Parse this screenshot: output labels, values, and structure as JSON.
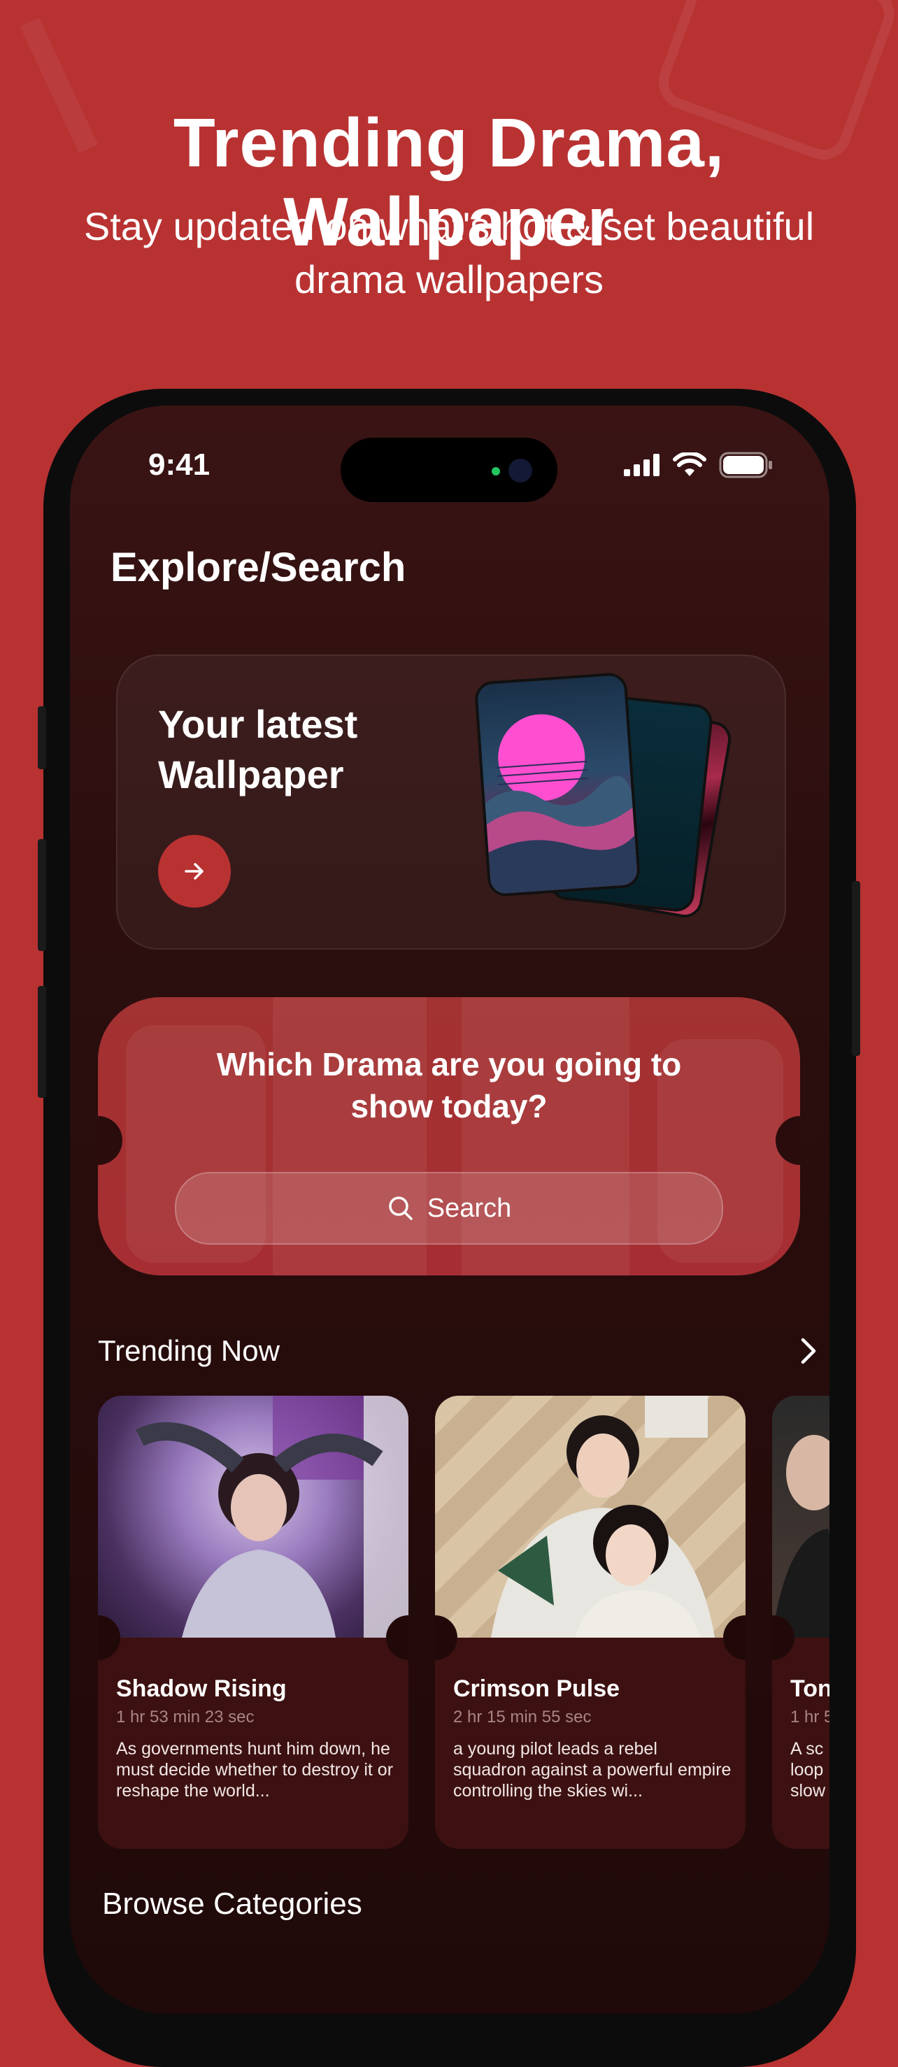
{
  "promo": {
    "headline": "Trending Drama, Wallpaper",
    "subline": "Stay updated on what's hot & set beautiful drama wallpapers"
  },
  "status_bar": {
    "time": "9:41"
  },
  "screen": {
    "title": "Explore/Search",
    "latest_wallpaper": {
      "title": "Your latest Wallpaper"
    },
    "search_card": {
      "question": "Which Drama are you going to show today?",
      "search_label": "Search"
    },
    "trending": {
      "title": "Trending Now",
      "items": [
        {
          "title": "Shadow Rising",
          "duration": "1 hr 53 min 23 sec",
          "description": "As governments hunt him down, he must decide whether to destroy it or reshape the world..."
        },
        {
          "title": "Crimson Pulse",
          "duration": "2 hr 15 min 55 sec",
          "description": "a young pilot leads a rebel squadron against a powerful empire controlling the skies wi..."
        },
        {
          "title": "Ton",
          "duration": "1 hr 5",
          "description": "A sc loop slow"
        }
      ]
    },
    "browse_title": "Browse Categories"
  },
  "colors": {
    "brand": "#b83232",
    "screen_bg": "#2c0e0e",
    "card_bg": "#3d1111"
  },
  "icons": [
    "arrow-right-icon",
    "search-icon",
    "chevron-right-icon",
    "signal-icon",
    "wifi-icon",
    "battery-icon"
  ]
}
